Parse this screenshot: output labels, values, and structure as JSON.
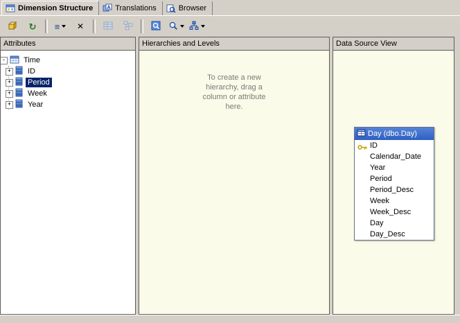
{
  "tabs": {
    "items": [
      {
        "label": "Dimension Structure",
        "icon": "dimension-structure-icon",
        "active": true
      },
      {
        "label": "Translations",
        "icon": "translations-icon",
        "active": false
      },
      {
        "label": "Browser",
        "icon": "browser-icon",
        "active": false
      }
    ]
  },
  "toolbar": {
    "buttons": [
      {
        "name": "process",
        "icon": "process-cube-icon"
      },
      {
        "name": "reconnect",
        "icon": "refresh-icon"
      },
      {
        "name": "attribute-view",
        "icon": "list-icon",
        "dropdown": true
      },
      {
        "name": "delete",
        "icon": "delete-x-icon"
      },
      {
        "name": "show-grid",
        "icon": "grid-icon"
      },
      {
        "name": "show-diagram",
        "icon": "diagram-icon"
      },
      {
        "name": "zoom-region",
        "icon": "zoom-region-icon"
      },
      {
        "name": "zoom",
        "icon": "magnifier-icon",
        "dropdown": true
      },
      {
        "name": "layout",
        "icon": "layout-icon",
        "dropdown": true
      }
    ]
  },
  "attributes_pane": {
    "title": "Attributes",
    "tree": {
      "root_label": "Time",
      "items": [
        {
          "label": "ID",
          "selected": false
        },
        {
          "label": "Period",
          "selected": true
        },
        {
          "label": "Week",
          "selected": false
        },
        {
          "label": "Year",
          "selected": false
        }
      ]
    }
  },
  "hierarchies_pane": {
    "title": "Hierarchies and Levels",
    "placeholder": "To create a new hierarchy, drag a column or attribute here."
  },
  "dsv_pane": {
    "title": "Data Source View",
    "table": {
      "title": "Day (dbo.Day)",
      "fields": [
        {
          "name": "ID",
          "key": true
        },
        {
          "name": "Calendar_Date",
          "key": false
        },
        {
          "name": "Year",
          "key": false
        },
        {
          "name": "Period",
          "key": false
        },
        {
          "name": "Period_Desc",
          "key": false
        },
        {
          "name": "Week",
          "key": false
        },
        {
          "name": "Week_Desc",
          "key": false
        },
        {
          "name": "Day",
          "key": false
        },
        {
          "name": "Day_Desc",
          "key": false
        }
      ]
    }
  },
  "colors": {
    "window_bg": "#d4d0c8",
    "canvas_bg": "#fbfbe9",
    "selection_bg": "#0a246a",
    "table_header_bg": "#316ac5",
    "placeholder_text": "#7a7a7a"
  }
}
